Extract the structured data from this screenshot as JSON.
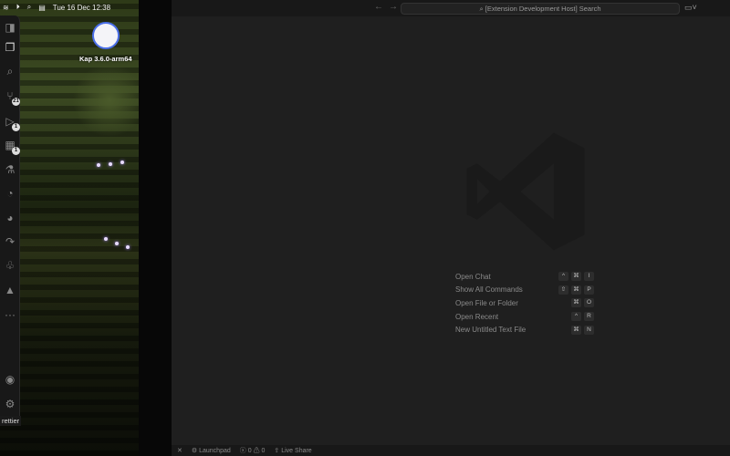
{
  "menubar": {
    "date_time": "Tue 16 Dec  12:38"
  },
  "kap": {
    "label": "Kap 3.6.0-arm64"
  },
  "activity_bar": {
    "items": [
      {
        "icon": "sidebar-toggle-icon",
        "glyph": "◨"
      },
      {
        "icon": "files-icon",
        "glyph": "❐"
      },
      {
        "icon": "search-icon",
        "glyph": "⌕"
      },
      {
        "icon": "source-control-icon",
        "glyph": "⑂",
        "badge": "21"
      },
      {
        "icon": "run-debug-icon",
        "glyph": "▷",
        "badge": "1"
      },
      {
        "icon": "extensions-icon",
        "glyph": "▦",
        "badge": "1"
      },
      {
        "icon": "testing-icon",
        "glyph": "⚗"
      },
      {
        "icon": "git-graph-icon",
        "glyph": "◔"
      },
      {
        "icon": "gitlens-icon",
        "glyph": "◕"
      },
      {
        "icon": "remote-icon",
        "glyph": "↷"
      },
      {
        "icon": "tree-icon",
        "glyph": "♧"
      },
      {
        "icon": "pyramid-icon",
        "glyph": "▲"
      },
      {
        "icon": "more-icon",
        "glyph": "···"
      }
    ],
    "bottom": [
      {
        "icon": "account-icon",
        "glyph": "◉"
      },
      {
        "icon": "settings-gear-icon",
        "glyph": "⚙"
      }
    ],
    "tooltip": "rettier"
  },
  "titlebar": {
    "search_placeholder": "[Extension Development Host] Search"
  },
  "commands": [
    {
      "label": "Open Chat",
      "keys": [
        "^",
        "⌘",
        "I"
      ]
    },
    {
      "label": "Show All Commands",
      "keys": [
        "⇧",
        "⌘",
        "P"
      ]
    },
    {
      "label": "Open File or Folder",
      "keys": [
        "⌘",
        "O"
      ]
    },
    {
      "label": "Open Recent",
      "keys": [
        "^",
        "R"
      ]
    },
    {
      "label": "New Untitled Text File",
      "keys": [
        "⌘",
        "N"
      ]
    }
  ],
  "statusbar": {
    "launchpad": "Launchpad",
    "errors": "0",
    "warnings": "0",
    "live_share": "Live Share"
  }
}
